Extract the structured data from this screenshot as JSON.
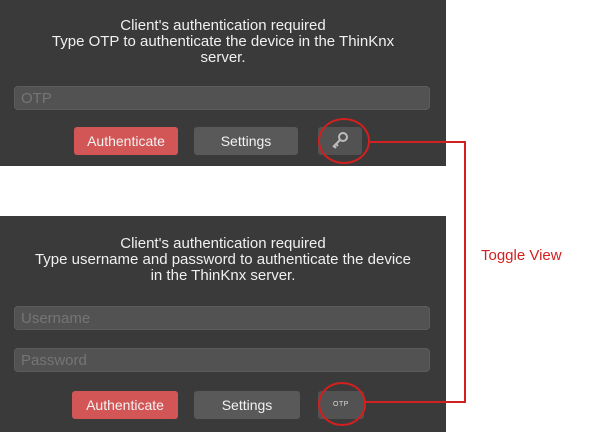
{
  "top_panel": {
    "message_line1": "Client's authentication required",
    "message_line2": "Type OTP to authenticate the device in the ThinKnx server.",
    "otp_placeholder": "OTP",
    "authenticate_label": "Authenticate",
    "settings_label": "Settings",
    "toggle_icon": "keys-icon"
  },
  "bottom_panel": {
    "message_line1": "Client's authentication required",
    "message_line2": "Type username and password to authenticate the device in the ThinKnx server.",
    "username_placeholder": "Username",
    "password_placeholder": "Password",
    "authenticate_label": "Authenticate",
    "settings_label": "Settings",
    "toggle_label": "OTP"
  },
  "annotation": {
    "label": "Toggle View",
    "color": "#d21f1f"
  },
  "colors": {
    "panel_bg": "#3a3a3a",
    "authenticate_button": "#d35656",
    "settings_button": "#595959"
  }
}
